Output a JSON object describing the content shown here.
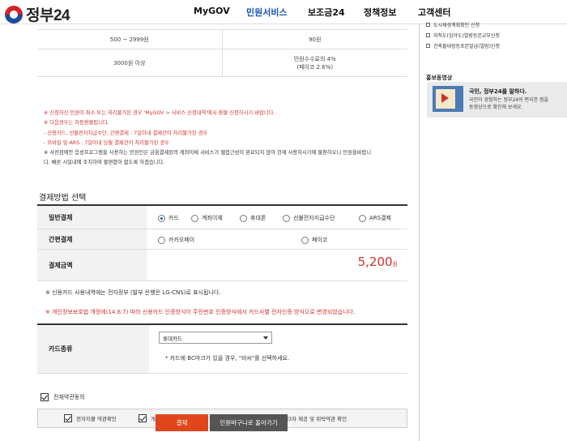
{
  "header": {
    "logo_text": "정부24",
    "nav": [
      "MyGOV",
      "민원서비스",
      "보조금24",
      "정책정보",
      "고객센터"
    ],
    "active_nav": "민원서비스"
  },
  "fee_table": {
    "rows": [
      {
        "range": "500 ~ 2999원",
        "fee": "90원",
        "fee2": ""
      },
      {
        "range": "3000원 이상",
        "fee": "민원수수료의 4%",
        "fee2": "(페이코 2.6%)"
      }
    ]
  },
  "notices": [
    "※ 신청하신 민원이 취소 또는 처리불가된 경우 'MyGOV > 서비스 신청내역'에서 환불 신청하시기 바랍니다.",
    "※ 다음경우는 자동환불됩니다.",
    "- 신용카드, 선불전자지급수단, 간편결제 : 7일이내 결제건이 처리불가된 경우",
    "- 모바일 및 ARS : 7일이내 당월 결제건이 처리불가된 경우",
    "※ 사전점에만 음성프로그램을 사용하는 민원인은 금융결제원의 계좌이체 서비스가 웹접근성이 완료되지 않아 현재 사용하시기에 불편하오니 민원을바랍니",
    "다. 빠른 시일내에 조치하여 불편함이 없도록 하겠습니다."
  ],
  "payment": {
    "section_title": "결제방법 선택",
    "general_label": "일반결제",
    "general_options": [
      "카드",
      "계좌이체",
      "휴대폰",
      "선불전자지급수단",
      "ARS결제"
    ],
    "general_selected": "카드",
    "simple_label": "간편결제",
    "simple_options": [
      "카카오페이",
      "페이코"
    ],
    "amount_label": "결제금액",
    "amount_value": "5,200",
    "amount_unit": "원"
  },
  "notes": {
    "card_statement": "※ 신용카드 사용내역에는 전자정부 (발부 은행은 LG-CNS)로 표시됩니다.",
    "privacy_notice": "※ 개인정보보호법 개정에(14.8.7) 따라 신용카드 인증방식이 주민번호 인증방식에서 카드사별 전자인증 방식으로 변경되었습니다."
  },
  "card": {
    "label": "카드종류",
    "selected": "롯데카드",
    "hint": "* 카드에 BC마크가 있을 경우, \"비씨\"를 선택하세요."
  },
  "agreements": {
    "all_label": "전체약관동의",
    "items": [
      "전자지불 약관확인",
      "개인정보수집 및 이용약관 확인",
      "개인정보 제3자 제공 및 위탁약관 확인"
    ]
  },
  "buttons": {
    "pay": "결제",
    "back": "민원바구니로 돌아가기"
  },
  "sidebar": {
    "links": [
      "도시재생계획확인 신청",
      "지적도(임야도)열람등본교부신청",
      "건축물대장등초본발급(열람)신청"
    ],
    "promo_title": "홍보동영상",
    "promo_heading": "국민, 정부24를 말하다.",
    "promo_desc": [
      "국민이 경험하는 정부24의 편리한 점을",
      "동영상으로 확인해 보세요."
    ]
  },
  "colors": {
    "accent_blue": "#1a56b8",
    "notice_red": "#d0302b",
    "pay_button": "#e0461c",
    "back_button": "#555555"
  }
}
